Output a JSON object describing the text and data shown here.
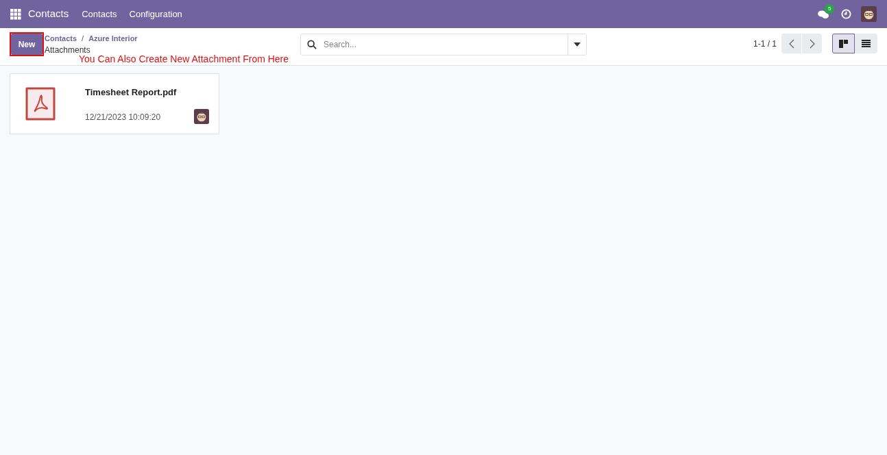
{
  "navbar": {
    "app_name": "Contacts",
    "menu": [
      "Contacts",
      "Configuration"
    ],
    "message_count": "5"
  },
  "control_panel": {
    "new_button": "New",
    "breadcrumbs": [
      "Contacts",
      "Azure Interior"
    ],
    "breadcrumb_separator": "/",
    "title": "Attachments",
    "annotation": "You Can Also Create New Attachment From Here",
    "search": {
      "placeholder": "Search..."
    },
    "pager": "1-1 / 1",
    "views": [
      {
        "kind": "kanban",
        "selected": true
      },
      {
        "kind": "list",
        "selected": false
      }
    ]
  },
  "cards": [
    {
      "name": "Timesheet Report.pdf",
      "date": "12/21/2023 10:09:20"
    }
  ]
}
